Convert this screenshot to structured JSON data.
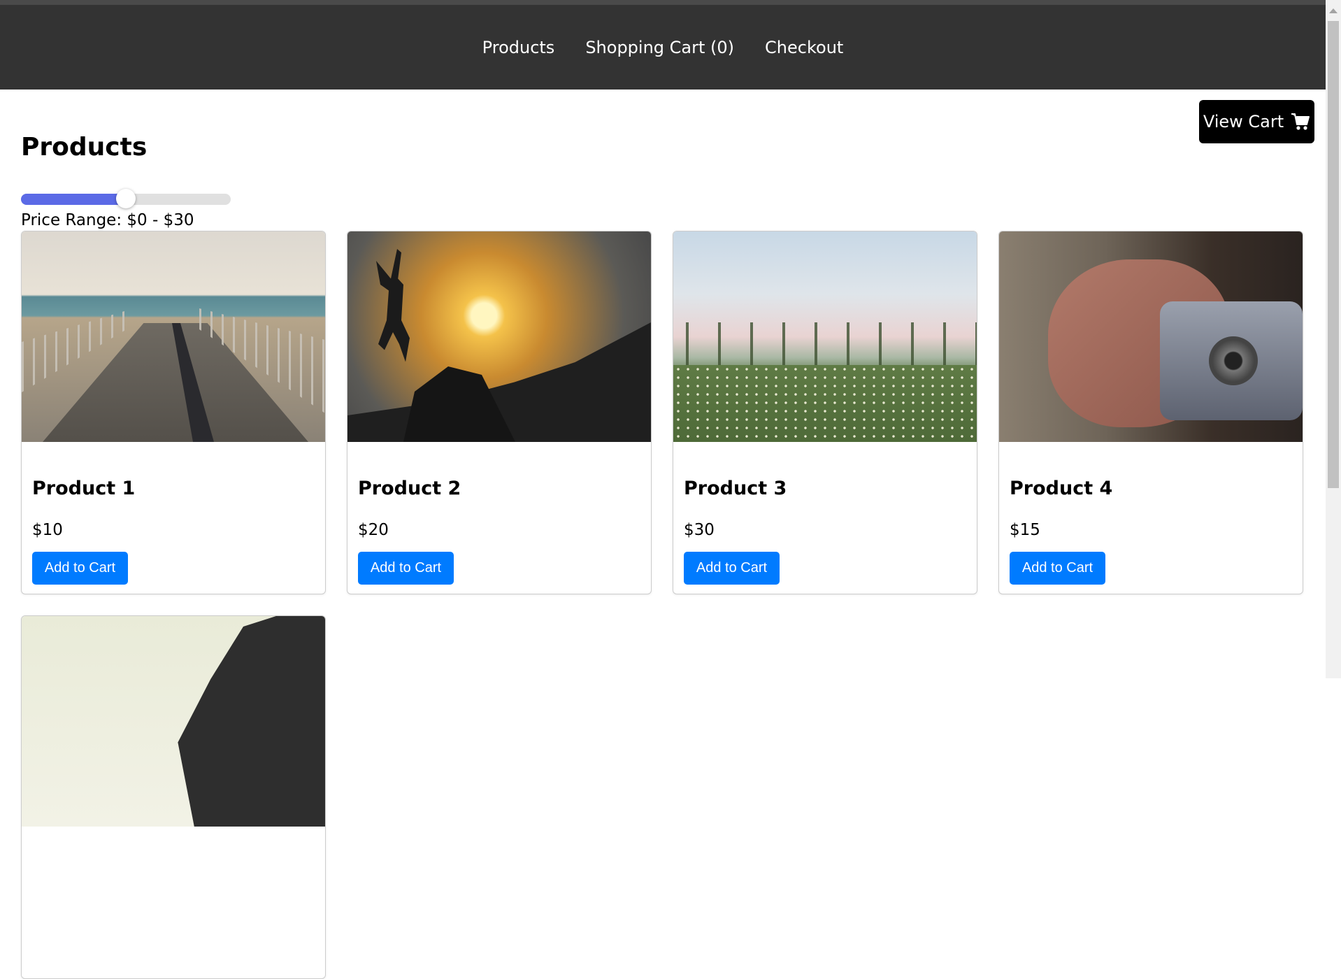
{
  "nav": {
    "links": [
      {
        "label": "Products"
      },
      {
        "label": "Shopping Cart (0)"
      },
      {
        "label": "Checkout"
      }
    ]
  },
  "view_cart": {
    "label": "View Cart",
    "icon": "cart-icon"
  },
  "page": {
    "title": "Products"
  },
  "price_filter": {
    "label": "Price Range: $0 - $30",
    "level_percent": 50,
    "accent_color": "#5b6ae6"
  },
  "products": [
    {
      "name": "Product 1",
      "price": "$10",
      "button": "Add to Cart"
    },
    {
      "name": "Product 2",
      "price": "$20",
      "button": "Add to Cart"
    },
    {
      "name": "Product 3",
      "price": "$30",
      "button": "Add to Cart"
    },
    {
      "name": "Product 4",
      "price": "$15",
      "button": "Add to Cart"
    }
  ],
  "colors": {
    "navbar": "#333333",
    "button": "#007bff",
    "view_cart_bg": "#000000"
  }
}
